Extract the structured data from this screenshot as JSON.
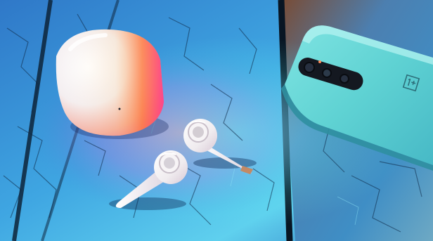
{
  "photo": {
    "subject": "",
    "colors": {
      "wood_blue": "#3d8fd8",
      "wood_cyan": "#39c9e6",
      "wood_dark": "#1c3e66",
      "crack_dark": "#0c1e33",
      "phone_mint": "#5fd6d4",
      "phone_mint_light": "#9eeceb",
      "case_white": "#f7f4f2",
      "glow_orange": "#ff8a3d",
      "glow_pink": "#ff4f8d",
      "glow_magenta": "#d24bd8",
      "camera_black": "#141820"
    },
    "phone_logo_icon": "oneplus-logo-icon"
  }
}
